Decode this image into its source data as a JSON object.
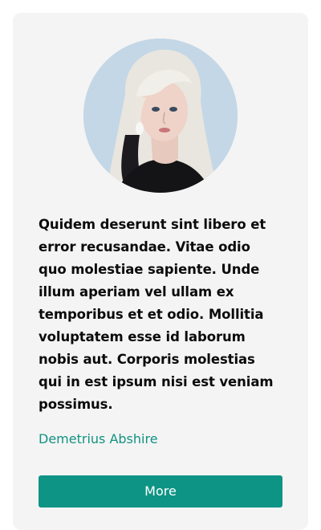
{
  "testimonial": {
    "avatar_alt": "",
    "quote": "Quidem deserunt sint libero et error recusandae. Vitae odio quo molestiae sapiente. Unde illum aperiam vel ullam ex temporibus et et odio. Mollitia voluptatem esse id laborum nobis aut. Corporis molestias qui in est ipsum nisi est veniam possimus.",
    "author": "Demetrius Abshire",
    "button_label": "More"
  },
  "colors": {
    "card_background": "#f4f4f4",
    "accent": "#0e9485",
    "author_text": "#129283",
    "quote_text": "#0b0b0b"
  }
}
